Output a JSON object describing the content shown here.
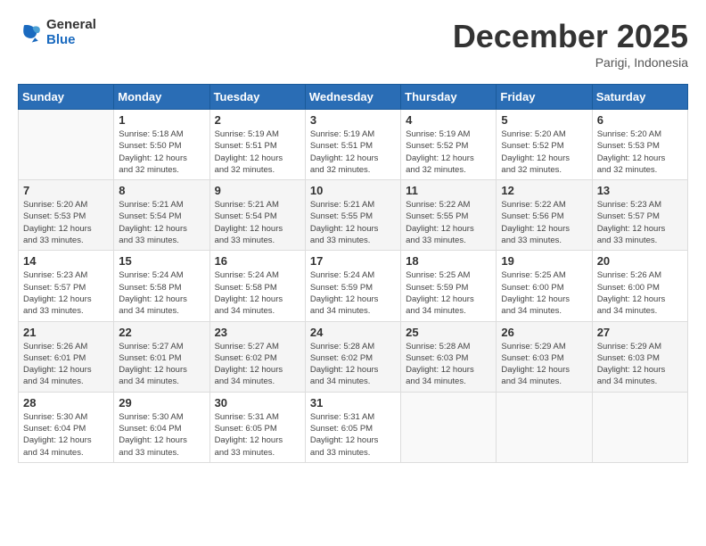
{
  "logo": {
    "general": "General",
    "blue": "Blue"
  },
  "header": {
    "month": "December 2025",
    "location": "Parigi, Indonesia"
  },
  "weekdays": [
    "Sunday",
    "Monday",
    "Tuesday",
    "Wednesday",
    "Thursday",
    "Friday",
    "Saturday"
  ],
  "weeks": [
    [
      {
        "day": "",
        "info": ""
      },
      {
        "day": "1",
        "info": "Sunrise: 5:18 AM\nSunset: 5:50 PM\nDaylight: 12 hours\nand 32 minutes."
      },
      {
        "day": "2",
        "info": "Sunrise: 5:19 AM\nSunset: 5:51 PM\nDaylight: 12 hours\nand 32 minutes."
      },
      {
        "day": "3",
        "info": "Sunrise: 5:19 AM\nSunset: 5:51 PM\nDaylight: 12 hours\nand 32 minutes."
      },
      {
        "day": "4",
        "info": "Sunrise: 5:19 AM\nSunset: 5:52 PM\nDaylight: 12 hours\nand 32 minutes."
      },
      {
        "day": "5",
        "info": "Sunrise: 5:20 AM\nSunset: 5:52 PM\nDaylight: 12 hours\nand 32 minutes."
      },
      {
        "day": "6",
        "info": "Sunrise: 5:20 AM\nSunset: 5:53 PM\nDaylight: 12 hours\nand 32 minutes."
      }
    ],
    [
      {
        "day": "7",
        "info": "Sunrise: 5:20 AM\nSunset: 5:53 PM\nDaylight: 12 hours\nand 33 minutes."
      },
      {
        "day": "8",
        "info": "Sunrise: 5:21 AM\nSunset: 5:54 PM\nDaylight: 12 hours\nand 33 minutes."
      },
      {
        "day": "9",
        "info": "Sunrise: 5:21 AM\nSunset: 5:54 PM\nDaylight: 12 hours\nand 33 minutes."
      },
      {
        "day": "10",
        "info": "Sunrise: 5:21 AM\nSunset: 5:55 PM\nDaylight: 12 hours\nand 33 minutes."
      },
      {
        "day": "11",
        "info": "Sunrise: 5:22 AM\nSunset: 5:55 PM\nDaylight: 12 hours\nand 33 minutes."
      },
      {
        "day": "12",
        "info": "Sunrise: 5:22 AM\nSunset: 5:56 PM\nDaylight: 12 hours\nand 33 minutes."
      },
      {
        "day": "13",
        "info": "Sunrise: 5:23 AM\nSunset: 5:57 PM\nDaylight: 12 hours\nand 33 minutes."
      }
    ],
    [
      {
        "day": "14",
        "info": "Sunrise: 5:23 AM\nSunset: 5:57 PM\nDaylight: 12 hours\nand 33 minutes."
      },
      {
        "day": "15",
        "info": "Sunrise: 5:24 AM\nSunset: 5:58 PM\nDaylight: 12 hours\nand 34 minutes."
      },
      {
        "day": "16",
        "info": "Sunrise: 5:24 AM\nSunset: 5:58 PM\nDaylight: 12 hours\nand 34 minutes."
      },
      {
        "day": "17",
        "info": "Sunrise: 5:24 AM\nSunset: 5:59 PM\nDaylight: 12 hours\nand 34 minutes."
      },
      {
        "day": "18",
        "info": "Sunrise: 5:25 AM\nSunset: 5:59 PM\nDaylight: 12 hours\nand 34 minutes."
      },
      {
        "day": "19",
        "info": "Sunrise: 5:25 AM\nSunset: 6:00 PM\nDaylight: 12 hours\nand 34 minutes."
      },
      {
        "day": "20",
        "info": "Sunrise: 5:26 AM\nSunset: 6:00 PM\nDaylight: 12 hours\nand 34 minutes."
      }
    ],
    [
      {
        "day": "21",
        "info": "Sunrise: 5:26 AM\nSunset: 6:01 PM\nDaylight: 12 hours\nand 34 minutes."
      },
      {
        "day": "22",
        "info": "Sunrise: 5:27 AM\nSunset: 6:01 PM\nDaylight: 12 hours\nand 34 minutes."
      },
      {
        "day": "23",
        "info": "Sunrise: 5:27 AM\nSunset: 6:02 PM\nDaylight: 12 hours\nand 34 minutes."
      },
      {
        "day": "24",
        "info": "Sunrise: 5:28 AM\nSunset: 6:02 PM\nDaylight: 12 hours\nand 34 minutes."
      },
      {
        "day": "25",
        "info": "Sunrise: 5:28 AM\nSunset: 6:03 PM\nDaylight: 12 hours\nand 34 minutes."
      },
      {
        "day": "26",
        "info": "Sunrise: 5:29 AM\nSunset: 6:03 PM\nDaylight: 12 hours\nand 34 minutes."
      },
      {
        "day": "27",
        "info": "Sunrise: 5:29 AM\nSunset: 6:03 PM\nDaylight: 12 hours\nand 34 minutes."
      }
    ],
    [
      {
        "day": "28",
        "info": "Sunrise: 5:30 AM\nSunset: 6:04 PM\nDaylight: 12 hours\nand 34 minutes."
      },
      {
        "day": "29",
        "info": "Sunrise: 5:30 AM\nSunset: 6:04 PM\nDaylight: 12 hours\nand 33 minutes."
      },
      {
        "day": "30",
        "info": "Sunrise: 5:31 AM\nSunset: 6:05 PM\nDaylight: 12 hours\nand 33 minutes."
      },
      {
        "day": "31",
        "info": "Sunrise: 5:31 AM\nSunset: 6:05 PM\nDaylight: 12 hours\nand 33 minutes."
      },
      {
        "day": "",
        "info": ""
      },
      {
        "day": "",
        "info": ""
      },
      {
        "day": "",
        "info": ""
      }
    ]
  ]
}
